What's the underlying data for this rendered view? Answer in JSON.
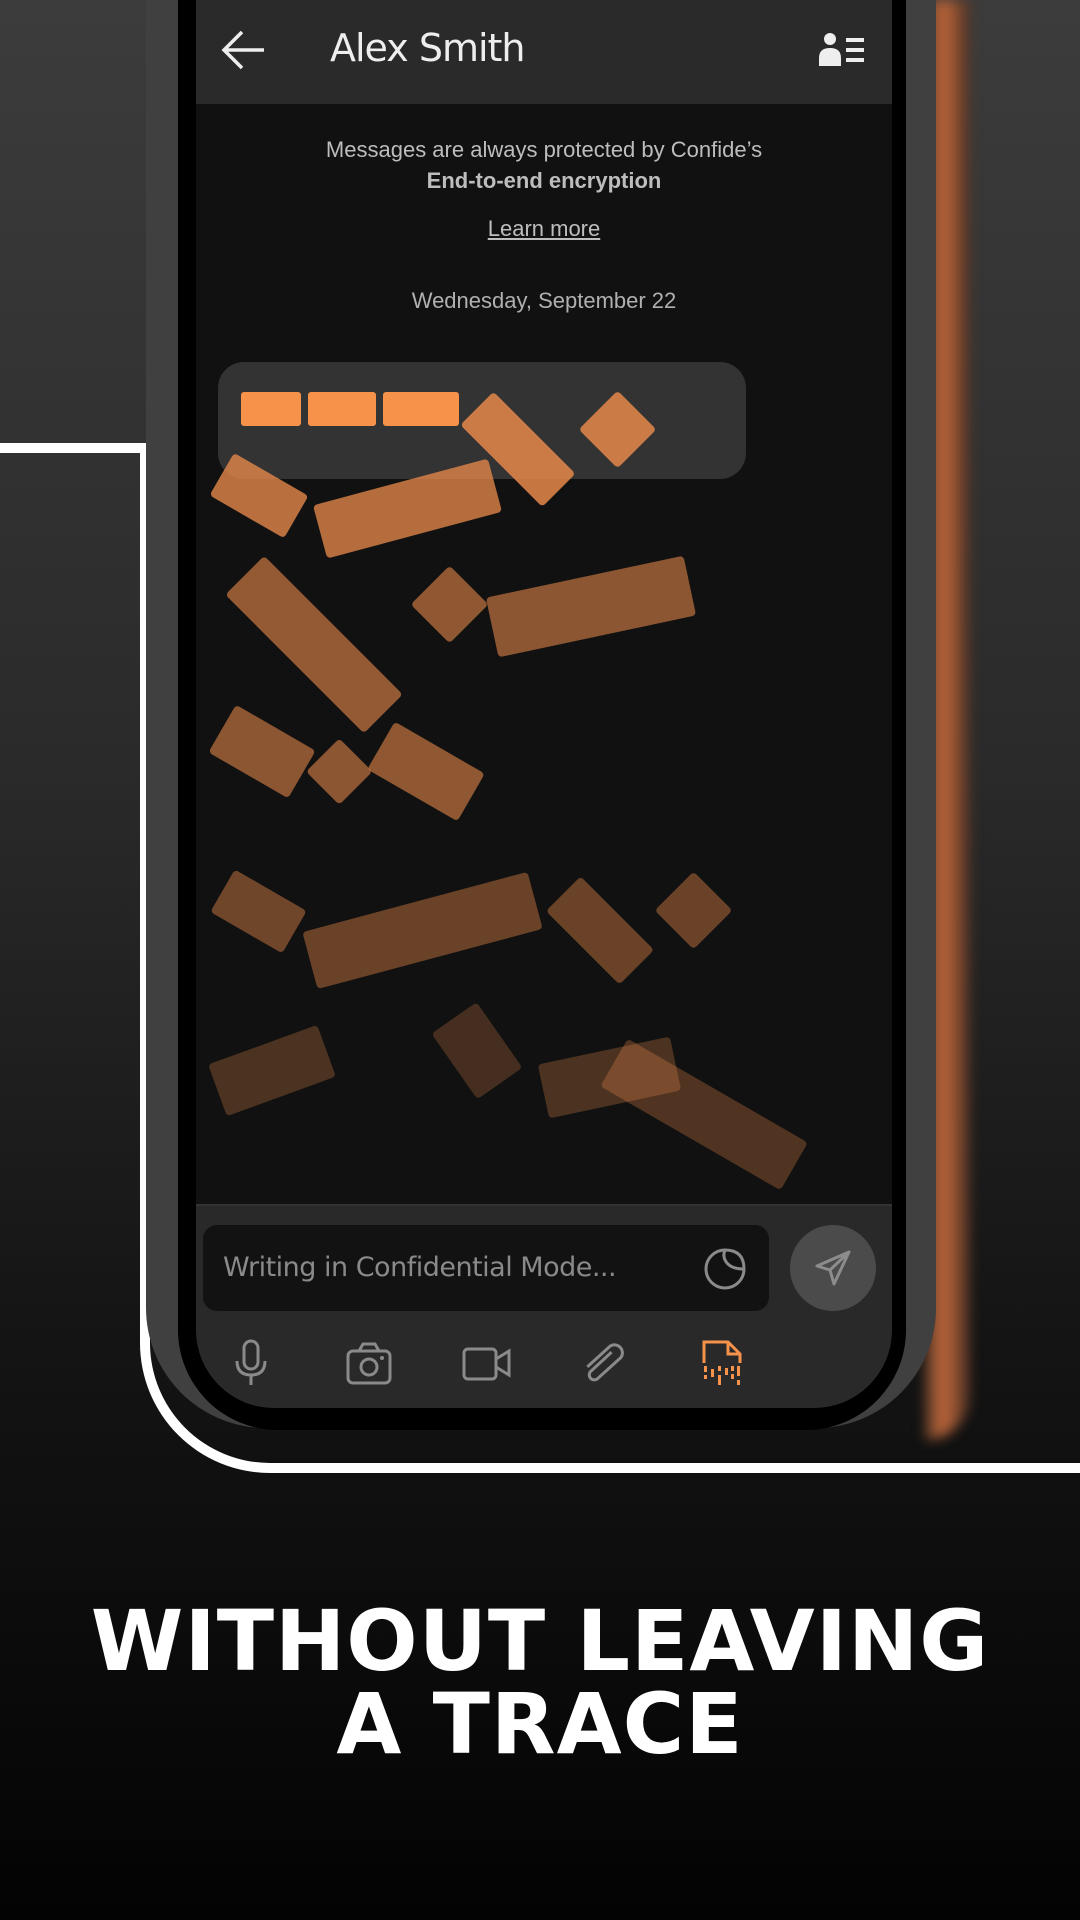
{
  "header": {
    "title": "Alex Smith",
    "back_icon": "arrow-left-icon",
    "contact_icon": "contact-list-icon"
  },
  "notice": {
    "line1": "Messages are always protected by Confide’s",
    "line2": "End-to-end encryption",
    "link": "Learn more"
  },
  "date_label": "Wednesday, September 22",
  "composer": {
    "placeholder": "Writing in Confidential Mode...",
    "sticker_icon": "sticker-icon",
    "send_icon": "send-icon"
  },
  "toolbar": [
    {
      "icon": "microphone-icon"
    },
    {
      "icon": "camera-icon"
    },
    {
      "icon": "video-icon"
    },
    {
      "icon": "paperclip-icon"
    },
    {
      "icon": "shredded-file-icon",
      "active": true
    }
  ],
  "colors": {
    "accent": "#f6924a",
    "background": "#111111",
    "header": "#2a2a2a"
  },
  "headline": {
    "line1": "WITHOUT LEAVING",
    "line2": "A TRACE"
  }
}
